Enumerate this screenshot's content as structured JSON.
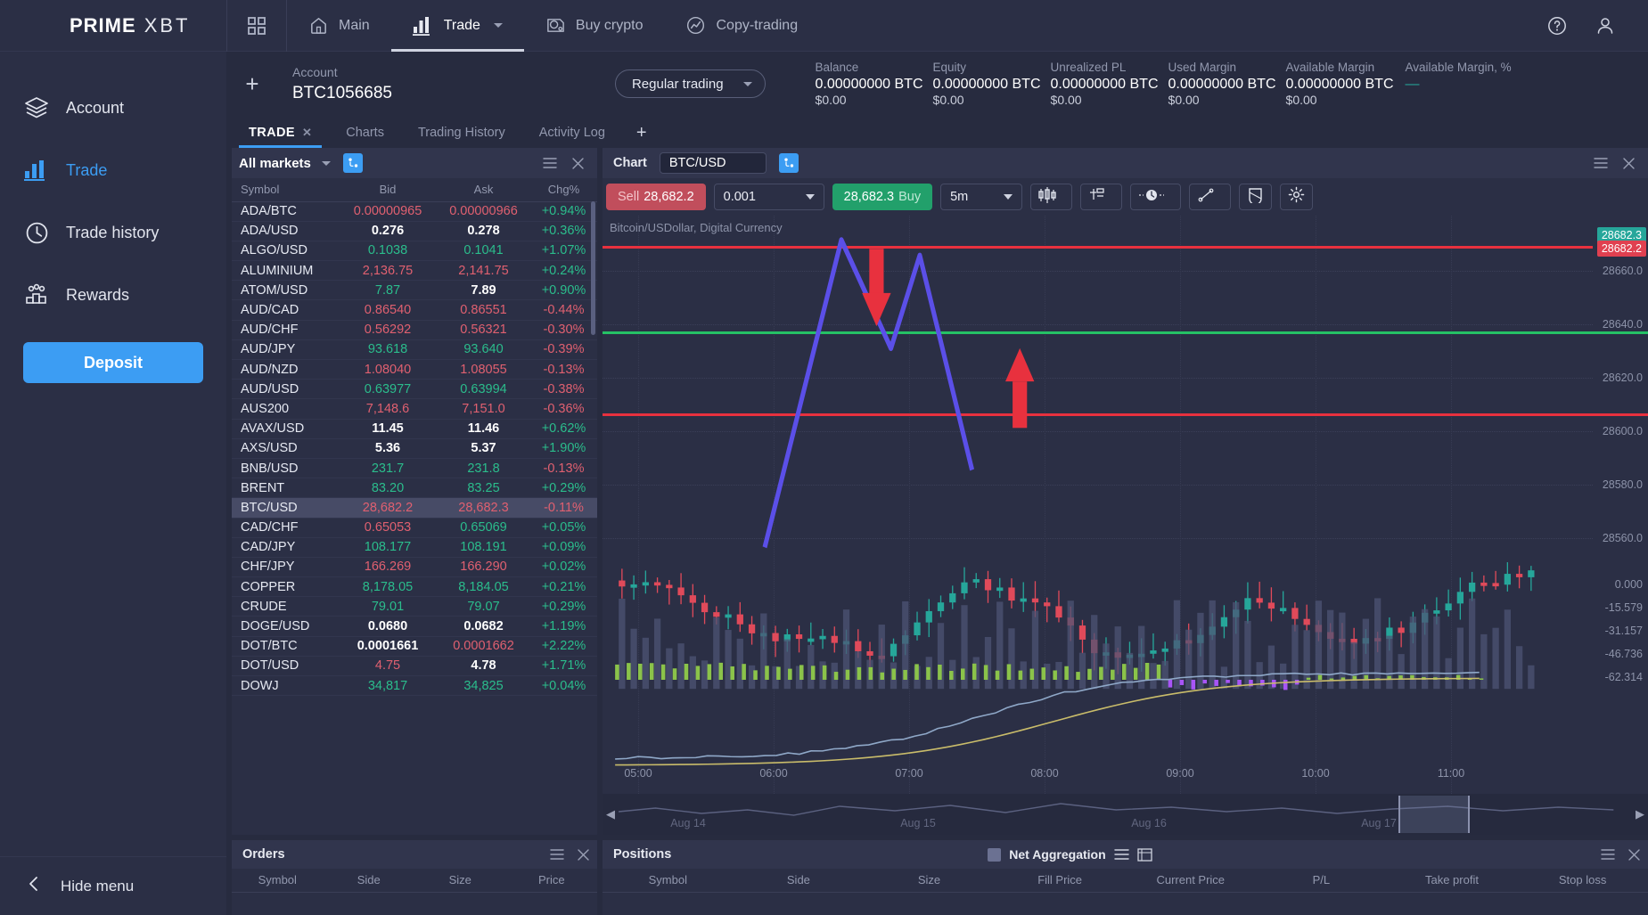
{
  "brand": {
    "prime": "PRIME",
    "xbt": "XBT"
  },
  "topnav": {
    "items": [
      {
        "label": "",
        "icon": "grid-icon"
      },
      {
        "label": "Main",
        "icon": "home-icon"
      },
      {
        "label": "Trade",
        "icon": "bars-icon",
        "caret": true,
        "active": true
      },
      {
        "label": "Buy crypto",
        "icon": "coins-icon"
      },
      {
        "label": "Copy-trading",
        "icon": "copy-trading-icon"
      }
    ],
    "help_icon": "help-icon",
    "profile_icon": "user-icon"
  },
  "sidebar": {
    "items": [
      {
        "label": "Account",
        "icon": "layers-icon",
        "active": false
      },
      {
        "label": "Trade",
        "icon": "bars-icon",
        "active": true
      },
      {
        "label": "Trade history",
        "icon": "clock-icon",
        "active": false
      },
      {
        "label": "Rewards",
        "icon": "people-icon",
        "active": false
      }
    ],
    "deposit_label": "Deposit",
    "hide_menu_label": "Hide menu"
  },
  "account": {
    "add_label": "+",
    "label": "Account",
    "value": "BTC1056685",
    "mode": "Regular trading",
    "stats": [
      {
        "label": "Balance",
        "value": "0.00000000 BTC",
        "sub": "$0.00"
      },
      {
        "label": "Equity",
        "value": "0.00000000 BTC",
        "sub": "$0.00"
      },
      {
        "label": "Unrealized PL",
        "value": "0.00000000 BTC",
        "sub": "$0.00"
      },
      {
        "label": "Used Margin",
        "value": "0.00000000 BTC",
        "sub": "$0.00"
      },
      {
        "label": "Available Margin",
        "value": "0.00000000 BTC",
        "sub": "$0.00"
      },
      {
        "label": "Available Margin, %",
        "value": "—",
        "sub": ""
      }
    ]
  },
  "tabs": {
    "items": [
      {
        "label": "TRADE",
        "active": true,
        "closable": true
      },
      {
        "label": "Charts",
        "active": false,
        "closable": false
      },
      {
        "label": "Trading History",
        "active": false,
        "closable": false
      },
      {
        "label": "Activity Log",
        "active": false,
        "closable": false
      }
    ],
    "add_label": "+"
  },
  "markets": {
    "title": "All markets",
    "columns": [
      "Symbol",
      "Bid",
      "Ask",
      "Chg%"
    ],
    "rows": [
      {
        "symbol": "ADA/BTC",
        "bid": "0.00000965",
        "bid_dir": "dn",
        "ask": "0.00000966",
        "ask_dir": "dn",
        "chg": "+0.94%",
        "chg_dir": "up"
      },
      {
        "symbol": "ADA/USD",
        "bid": "0.276",
        "bid_dir": "neu",
        "ask": "0.278",
        "ask_dir": "neu",
        "chg": "+0.36%",
        "chg_dir": "up"
      },
      {
        "symbol": "ALGO/USD",
        "bid": "0.1038",
        "bid_dir": "up",
        "ask": "0.1041",
        "ask_dir": "up",
        "chg": "+1.07%",
        "chg_dir": "up"
      },
      {
        "symbol": "ALUMINIUM",
        "bid": "2,136.75",
        "bid_dir": "dn",
        "ask": "2,141.75",
        "ask_dir": "dn",
        "chg": "+0.24%",
        "chg_dir": "up"
      },
      {
        "symbol": "ATOM/USD",
        "bid": "7.87",
        "bid_dir": "up",
        "ask": "7.89",
        "ask_dir": "neu",
        "chg": "+0.90%",
        "chg_dir": "up"
      },
      {
        "symbol": "AUD/CAD",
        "bid": "0.86540",
        "bid_dir": "dn",
        "ask": "0.86551",
        "ask_dir": "dn",
        "chg": "-0.44%",
        "chg_dir": "dn"
      },
      {
        "symbol": "AUD/CHF",
        "bid": "0.56292",
        "bid_dir": "dn",
        "ask": "0.56321",
        "ask_dir": "dn",
        "chg": "-0.30%",
        "chg_dir": "dn"
      },
      {
        "symbol": "AUD/JPY",
        "bid": "93.618",
        "bid_dir": "up",
        "ask": "93.640",
        "ask_dir": "up",
        "chg": "-0.39%",
        "chg_dir": "dn"
      },
      {
        "symbol": "AUD/NZD",
        "bid": "1.08040",
        "bid_dir": "dn",
        "ask": "1.08055",
        "ask_dir": "dn",
        "chg": "-0.13%",
        "chg_dir": "dn"
      },
      {
        "symbol": "AUD/USD",
        "bid": "0.63977",
        "bid_dir": "up",
        "ask": "0.63994",
        "ask_dir": "up",
        "chg": "-0.38%",
        "chg_dir": "dn"
      },
      {
        "symbol": "AUS200",
        "bid": "7,148.6",
        "bid_dir": "dn",
        "ask": "7,151.0",
        "ask_dir": "dn",
        "chg": "-0.36%",
        "chg_dir": "dn"
      },
      {
        "symbol": "AVAX/USD",
        "bid": "11.45",
        "bid_dir": "neu",
        "ask": "11.46",
        "ask_dir": "neu",
        "chg": "+0.62%",
        "chg_dir": "up"
      },
      {
        "symbol": "AXS/USD",
        "bid": "5.36",
        "bid_dir": "neu",
        "ask": "5.37",
        "ask_dir": "neu",
        "chg": "+1.90%",
        "chg_dir": "up"
      },
      {
        "symbol": "BNB/USD",
        "bid": "231.7",
        "bid_dir": "up",
        "ask": "231.8",
        "ask_dir": "up",
        "chg": "-0.13%",
        "chg_dir": "dn"
      },
      {
        "symbol": "BRENT",
        "bid": "83.20",
        "bid_dir": "up",
        "ask": "83.25",
        "ask_dir": "up",
        "chg": "+0.29%",
        "chg_dir": "up"
      },
      {
        "symbol": "BTC/USD",
        "bid": "28,682.2",
        "bid_dir": "dn",
        "ask": "28,682.3",
        "ask_dir": "dn",
        "chg": "-0.11%",
        "chg_dir": "dn",
        "selected": true
      },
      {
        "symbol": "CAD/CHF",
        "bid": "0.65053",
        "bid_dir": "dn",
        "ask": "0.65069",
        "ask_dir": "up",
        "chg": "+0.05%",
        "chg_dir": "up"
      },
      {
        "symbol": "CAD/JPY",
        "bid": "108.177",
        "bid_dir": "up",
        "ask": "108.191",
        "ask_dir": "up",
        "chg": "+0.09%",
        "chg_dir": "up"
      },
      {
        "symbol": "CHF/JPY",
        "bid": "166.269",
        "bid_dir": "dn",
        "ask": "166.290",
        "ask_dir": "dn",
        "chg": "+0.02%",
        "chg_dir": "up"
      },
      {
        "symbol": "COPPER",
        "bid": "8,178.05",
        "bid_dir": "up",
        "ask": "8,184.05",
        "ask_dir": "up",
        "chg": "+0.21%",
        "chg_dir": "up"
      },
      {
        "symbol": "CRUDE",
        "bid": "79.01",
        "bid_dir": "up",
        "ask": "79.07",
        "ask_dir": "up",
        "chg": "+0.29%",
        "chg_dir": "up"
      },
      {
        "symbol": "DOGE/USD",
        "bid": "0.0680",
        "bid_dir": "neu",
        "ask": "0.0682",
        "ask_dir": "neu",
        "chg": "+1.19%",
        "chg_dir": "up"
      },
      {
        "symbol": "DOT/BTC",
        "bid": "0.0001661",
        "bid_dir": "neu",
        "ask": "0.0001662",
        "ask_dir": "dn",
        "chg": "+2.22%",
        "chg_dir": "up"
      },
      {
        "symbol": "DOT/USD",
        "bid": "4.75",
        "bid_dir": "dn",
        "ask": "4.78",
        "ask_dir": "neu",
        "chg": "+1.71%",
        "chg_dir": "up"
      },
      {
        "symbol": "DOWJ",
        "bid": "34,817",
        "bid_dir": "up",
        "ask": "34,825",
        "ask_dir": "up",
        "chg": "+0.04%",
        "chg_dir": "up"
      }
    ]
  },
  "chart": {
    "panel_title": "Chart",
    "symbol": "BTC/USD",
    "swap_icon": "swap-icon",
    "sell": {
      "prefix": "Sell",
      "price": "28,682.2"
    },
    "buy": {
      "price": "28,682.3",
      "suffix": "Buy"
    },
    "quantity": "0.001",
    "timeframe": "5m",
    "subtitle": "Bitcoin/USDollar, Digital Currency",
    "tools": [
      {
        "icon": "candles-icon",
        "caret": true
      },
      {
        "icon": "indicators-icon",
        "caret": true
      },
      {
        "icon": "clock-icon",
        "caret": true
      },
      {
        "icon": "trendline-icon",
        "caret": true
      },
      {
        "icon": "magnet-icon",
        "caret": false
      },
      {
        "icon": "gear-icon",
        "caret": false
      }
    ],
    "chart_data": {
      "type": "candlestick",
      "title": "Bitcoin/USDollar, Digital Currency",
      "symbol": "BTC/USD",
      "timeframe": "5m",
      "last_price": "28682.3",
      "prev_price": "28682.2",
      "price_ticks": [
        "28660.0",
        "28640.0",
        "28620.0",
        "28600.0",
        "28580.0",
        "28560.0"
      ],
      "price_min": 28550,
      "price_max": 28690,
      "time_ticks": [
        "05:00",
        "06:00",
        "07:00",
        "08:00",
        "09:00",
        "10:00",
        "11:00"
      ],
      "levels": [
        {
          "price": "28682.3",
          "color": "#e8313e",
          "label": "resistance-upper"
        },
        {
          "price": "28637.0",
          "color": "#25c165",
          "label": "support-green"
        },
        {
          "price": "28606.0",
          "color": "#e8313e",
          "label": "support-lower"
        }
      ],
      "indicator_ticks": [
        "0.000",
        "-15.579",
        "-31.157",
        "-46.736",
        "-62.314"
      ],
      "nav_labels": [
        "Aug 14",
        "Aug 15",
        "Aug 16",
        "Aug 17"
      ]
    }
  },
  "orders": {
    "title": "Orders",
    "columns": [
      "Symbol",
      "Side",
      "Size",
      "Price"
    ],
    "rows": []
  },
  "positions": {
    "title": "Positions",
    "net_aggregation_label": "Net Aggregation",
    "columns": [
      "Symbol",
      "Side",
      "Size",
      "Fill Price",
      "Current Price",
      "P/L",
      "Take profit",
      "Stop loss"
    ],
    "rows": []
  },
  "colors": {
    "accent": "#3c9df3",
    "up": "#2bbd8c",
    "down": "#e06070",
    "sell": "#c14e5c",
    "buy": "#22a06b",
    "panel": "#2b2f45",
    "background": "#272b3f"
  }
}
